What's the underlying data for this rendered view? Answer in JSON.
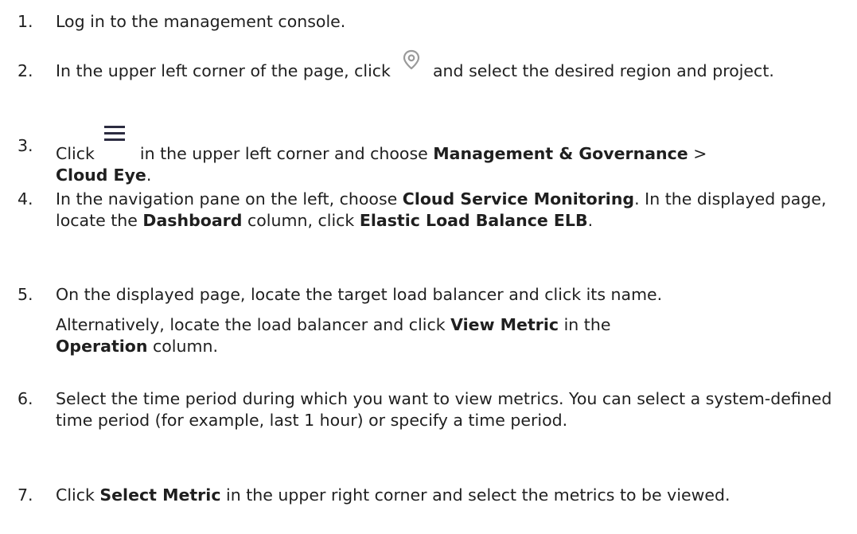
{
  "steps": [
    {
      "number": "1.",
      "text": "Log in to the management console."
    },
    {
      "number": "2.",
      "before": "In the upper left corner of the page, click",
      "icon": "location-pin-icon",
      "after": "and select the desired region and project."
    },
    {
      "number": "3.",
      "before": "Click",
      "icon": "hamburger-menu-icon",
      "mid": "in the upper left corner and choose",
      "bold1": "Management & Governance",
      "sep": ">",
      "bold2": "Cloud Eye",
      "end": "."
    },
    {
      "number": "4.",
      "t1": "In the navigation pane on the left, choose",
      "b1": "Cloud Service Monitoring",
      "t2": ". In the displayed page, locate the",
      "b2": "Dashboard",
      "t3": "column, click",
      "b3": "Elastic Load Balance ELB",
      "t4": "."
    },
    {
      "number": "5.",
      "text": "On the displayed page, locate the target load balancer and click its name.",
      "sub_t1": "Alternatively, locate the load balancer and click",
      "sub_b1": "View Metric",
      "sub_t2": "in the",
      "sub_b2": "Operation",
      "sub_t3": "column."
    },
    {
      "number": "6.",
      "text": "Select the time period during which you want to view metrics. You can select a system-defined time period (for example, last 1 hour) or specify a time period."
    },
    {
      "number": "7.",
      "t1": "Click",
      "b1": "Select Metric",
      "t2": "in the upper right corner and select the metrics to be viewed."
    }
  ],
  "colors": {
    "text": "#1f1f1f",
    "icon": "#9a9a9a",
    "menu_icon": "#2b2b40"
  }
}
